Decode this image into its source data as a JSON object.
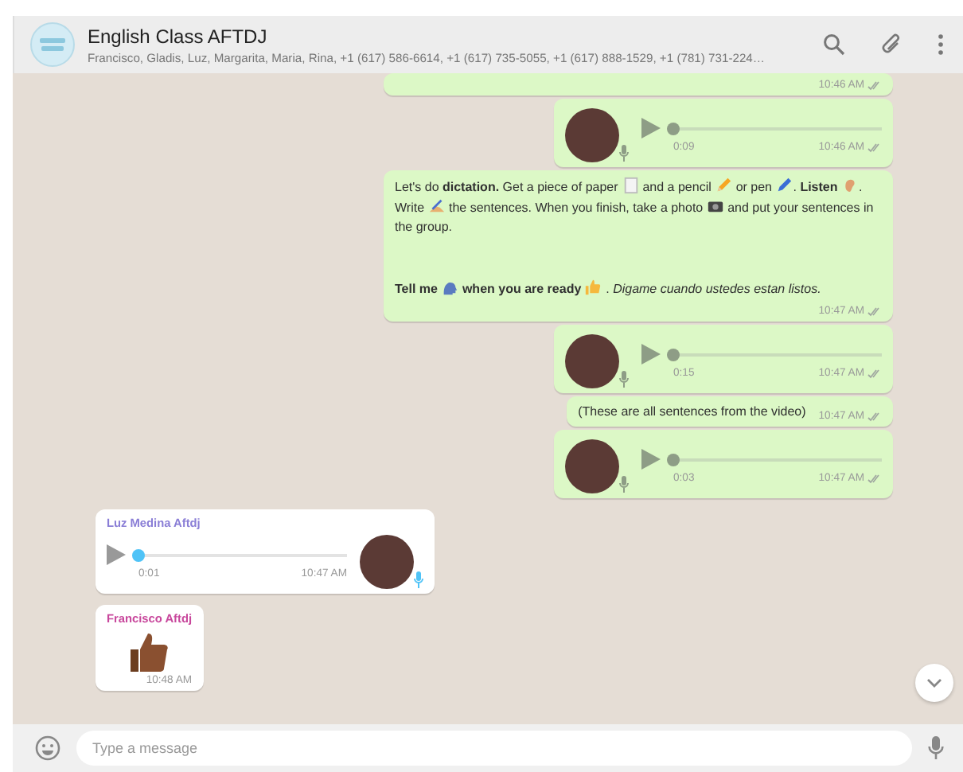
{
  "header": {
    "title": "English Class AFTDJ",
    "subtitle": "Francisco, Gladis, Luz, Margarita, Maria, Rina, +1 (617) 586-6614, +1 (617) 735-5055, +1 (617) 888-1529, +1 (781) 731-224…"
  },
  "messages": [
    {
      "kind": "cut",
      "outgoing": true,
      "time": "10:46 AM",
      "delivered": true
    },
    {
      "kind": "voice",
      "outgoing": true,
      "duration": "0:09",
      "time": "10:46 AM",
      "delivered": true,
      "played": true,
      "level": 0
    },
    {
      "kind": "text",
      "outgoing": true,
      "time": "10:47 AM",
      "delivered": true,
      "paragraphs": [
        [
          {
            "kind": "text",
            "text": "Let's do **dictation.** Get a piece of paper "
          },
          {
            "kind": "paper"
          },
          {
            "kind": "text",
            "text": " and a pencil "
          },
          {
            "kind": "pencil"
          },
          {
            "kind": "text",
            "text": " or pen "
          },
          {
            "kind": "pen"
          },
          {
            "kind": "text",
            "text": ". **Listen** "
          },
          {
            "kind": "ear"
          },
          {
            "kind": "text",
            "text": ". Write "
          },
          {
            "kind": "writing-hand"
          },
          {
            "kind": "text",
            "text": " the sentences. When you finish, take a photo "
          },
          {
            "kind": "camera"
          },
          {
            "kind": "text",
            "text": " and put your sentences in the group."
          }
        ],
        [
          {
            "kind": "text",
            "text": "**Tell me** "
          },
          {
            "kind": "speaking-head"
          },
          {
            "kind": "text",
            "text": " **when you are ready** "
          },
          {
            "kind": "thumbs-up"
          },
          {
            "kind": "text",
            "text": " . *Digame cuando ustedes estan listos.*"
          }
        ]
      ]
    },
    {
      "kind": "voice",
      "outgoing": true,
      "duration": "0:15",
      "time": "10:47 AM",
      "delivered": true,
      "played": true,
      "level": 0
    },
    {
      "kind": "text",
      "outgoing": true,
      "time": "10:47 AM",
      "delivered": true,
      "paragraphs": [
        [
          {
            "kind": "text",
            "text": "(These are all sentences from the video)"
          }
        ]
      ]
    },
    {
      "kind": "voice",
      "outgoing": true,
      "duration": "0:03",
      "time": "10:47 AM",
      "delivered": true,
      "played": true,
      "level": 0
    },
    {
      "kind": "voice",
      "outgoing": false,
      "sender": "Luz Medina Aftdj",
      "color": "#8a7ed6",
      "duration": "0:01",
      "time": "10:47 AM",
      "played": false,
      "level": 0
    },
    {
      "kind": "sticker",
      "outgoing": false,
      "sender": "Francisco Aftdj",
      "color": "#c8479c",
      "time": "10:48 AM"
    }
  ],
  "composer": {
    "placeholder": "Type a message"
  }
}
